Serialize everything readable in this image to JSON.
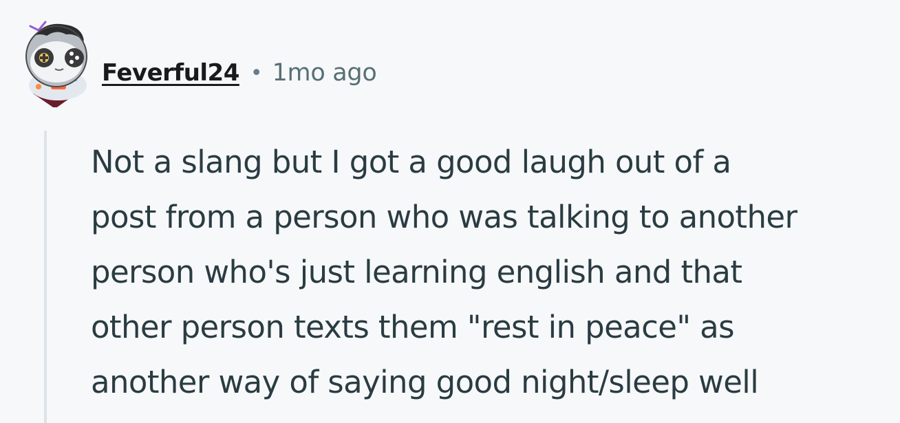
{
  "comment": {
    "author": "Feverful24",
    "separator": "•",
    "timestamp": "1mo ago",
    "avatar_icon": "snoo-avatar-icon",
    "body_lines": [
      "Not a slang but I got a good laugh out of a",
      "post from a person who was talking to another",
      "person who's just learning english and that",
      "other person texts them \"rest in peace\" as",
      "another way of saying good night/sleep well"
    ]
  }
}
